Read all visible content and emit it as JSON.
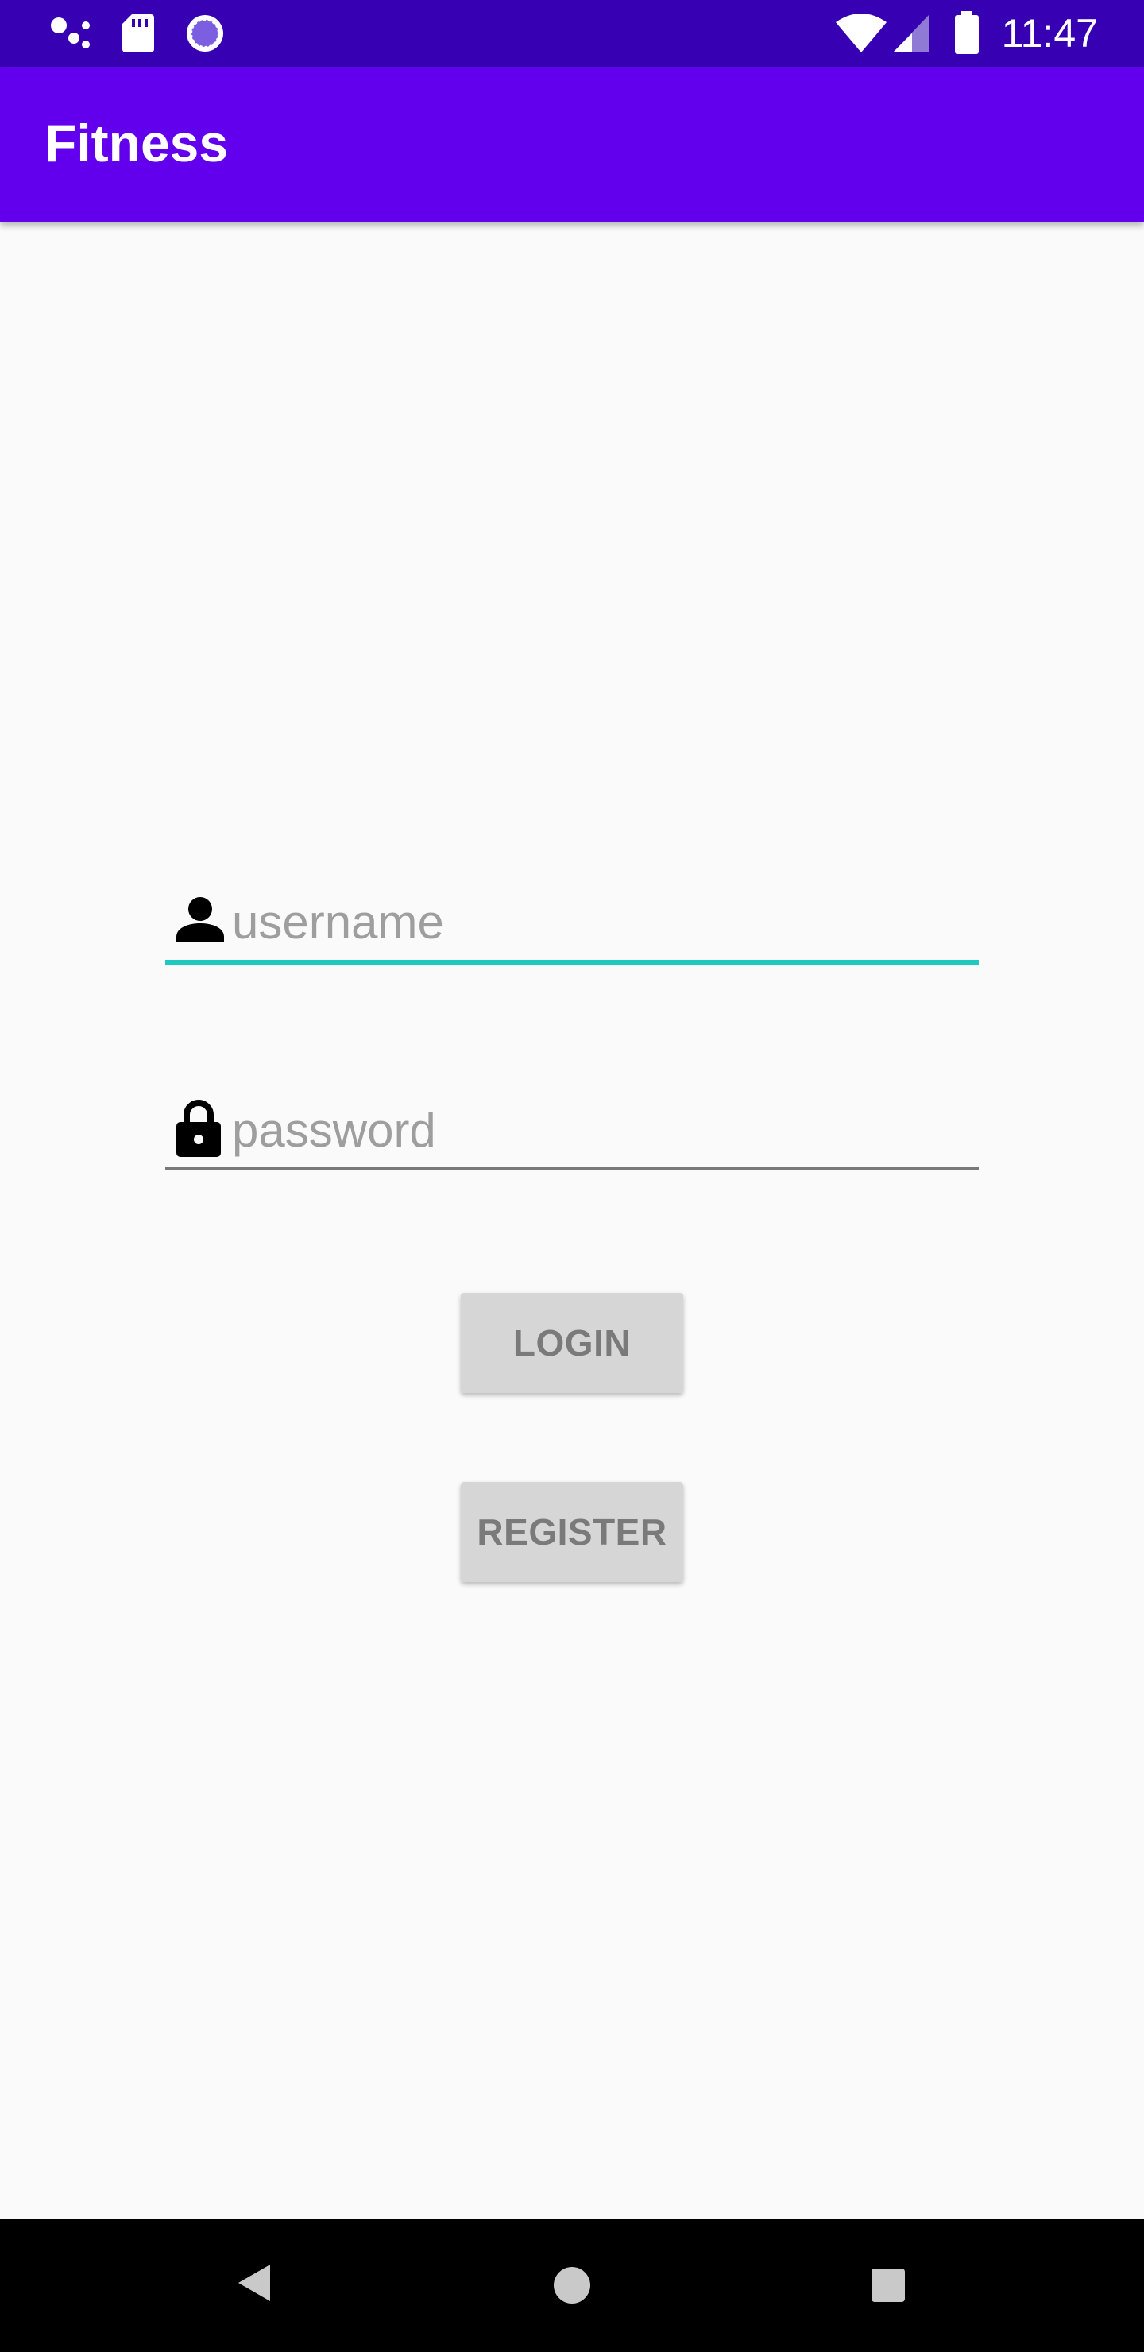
{
  "status_bar": {
    "time": "11:47",
    "icons": [
      "assistant-dots-icon",
      "sd-card-icon",
      "sync-circle-icon",
      "wifi-icon",
      "cell-signal-icon",
      "battery-icon"
    ]
  },
  "app_bar": {
    "title": "Fitness"
  },
  "login_form": {
    "username": {
      "placeholder": "username",
      "value": "",
      "icon": "person-icon"
    },
    "password": {
      "placeholder": "password",
      "value": "",
      "icon": "lock-icon"
    },
    "login_label": "LOGIN",
    "register_label": "REGISTER"
  },
  "nav_bar": {
    "icons": [
      "back-icon",
      "home-icon",
      "recents-icon"
    ]
  },
  "colors": {
    "status_bar": "#3700b3",
    "app_bar": "#6200ee",
    "background": "#fafafa",
    "focused_underline": "#1ec9c0",
    "underline": "#7a7a7a",
    "button": "#d6d6d6",
    "button_text": "#7a7a7a",
    "nav_bar": "#000000"
  }
}
